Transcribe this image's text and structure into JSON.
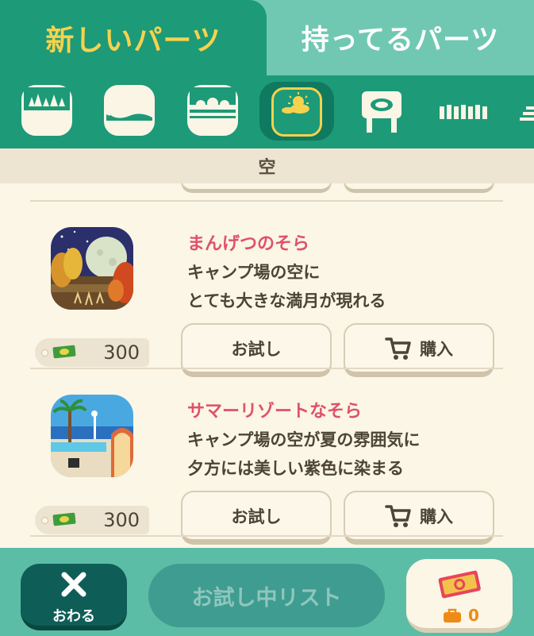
{
  "tabs": {
    "new_parts": "新しいパーツ",
    "owned_parts": "持ってるパーツ"
  },
  "categories": [
    {
      "icon": "trees-icon",
      "selected": false
    },
    {
      "icon": "cloth-icon",
      "selected": false
    },
    {
      "icon": "waves-icon",
      "selected": false
    },
    {
      "icon": "sky-icon",
      "selected": true
    },
    {
      "icon": "signboard-icon",
      "selected": false
    },
    {
      "icon": "fence-icon",
      "selected": false
    },
    {
      "icon": "stairs-icon",
      "selected": false
    }
  ],
  "section_title": "空",
  "items": [
    {
      "name": "まんげつのそら",
      "desc_line1": "キャンプ場の空に",
      "desc_line2": "とても大きな満月が現れる",
      "price": "300",
      "try_label": "お試し",
      "buy_label": "購入"
    },
    {
      "name": "サマーリゾートなそら",
      "desc_line1": "キャンプ場の空が夏の雰囲気に",
      "desc_line2": "夕方には美しい紫色に染まる",
      "price": "300",
      "try_label": "お試し",
      "buy_label": "購入"
    }
  ],
  "bottom": {
    "close_label": "おわる",
    "try_list_label": "お試し中リスト",
    "ticket_count": "0"
  },
  "colors": {
    "tab_active": "#1d9a78",
    "tab_active_text": "#f6d24d",
    "accent_name": "#e0506c",
    "background": "#fbf6e6",
    "ticket_count": "#f08a16"
  }
}
